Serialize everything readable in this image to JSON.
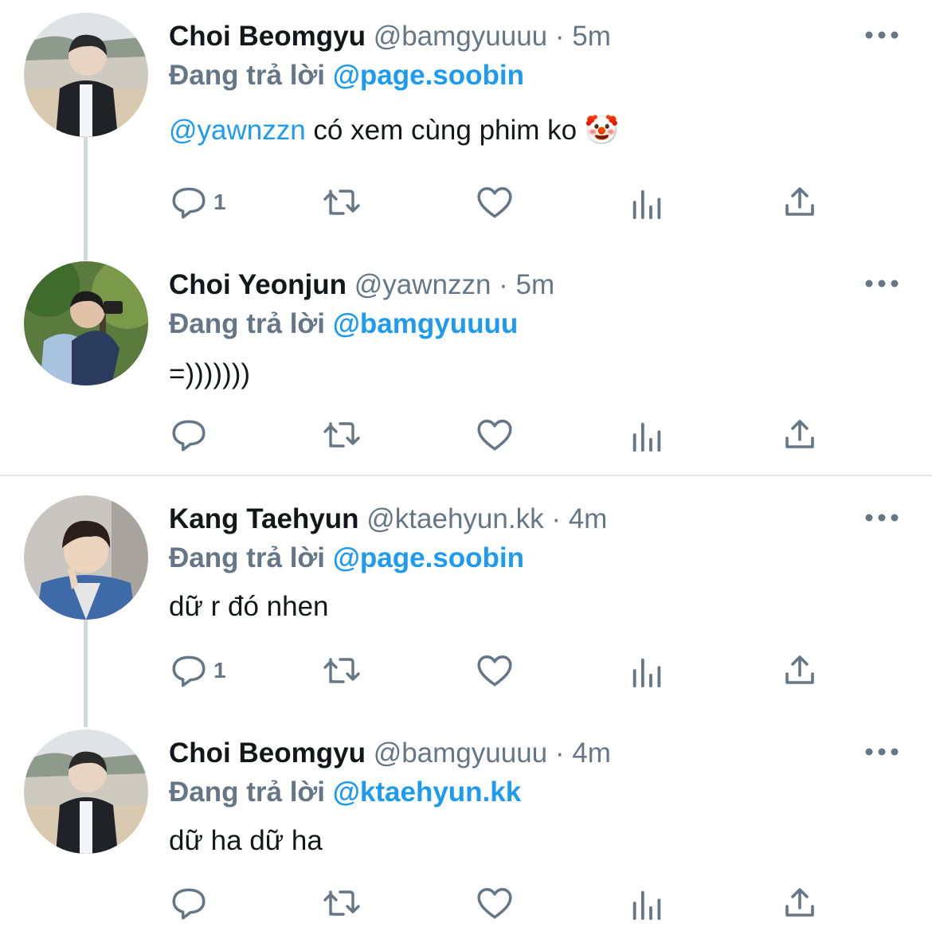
{
  "reply_prefix": "Đang trả lời",
  "colors": {
    "mention": "#1d9bf0",
    "muted": "#657786",
    "thread_line": "#cfd9de"
  },
  "tweets": [
    {
      "name": "Choi Beomgyu",
      "handle": "@bamgyuuuu",
      "separator": "·",
      "time": "5m",
      "reply_to": "@page.soobin",
      "text_mention": "@yawnzzn",
      "text": " có xem cùng phim ko 🤡",
      "reply_count": "1"
    },
    {
      "name": "Choi Yeonjun",
      "handle": "@yawnzzn",
      "separator": "·",
      "time": "5m",
      "reply_to": "@bamgyuuuu",
      "text_mention": "",
      "text": "=)))))))",
      "reply_count": ""
    },
    {
      "name": "Kang Taehyun",
      "handle": "@ktaehyun.kk",
      "separator": "·",
      "time": "4m",
      "reply_to": "@page.soobin",
      "text_mention": "",
      "text": "dữ r đó nhen",
      "reply_count": "1"
    },
    {
      "name": "Choi Beomgyu",
      "handle": "@bamgyuuuu",
      "separator": "·",
      "time": "4m",
      "reply_to": "@ktaehyun.kk",
      "text_mention": "",
      "text": "dữ ha dữ ha",
      "reply_count": ""
    }
  ],
  "icons": [
    "reply-icon",
    "retweet-icon",
    "like-icon",
    "analytics-icon",
    "share-icon",
    "more-icon"
  ]
}
